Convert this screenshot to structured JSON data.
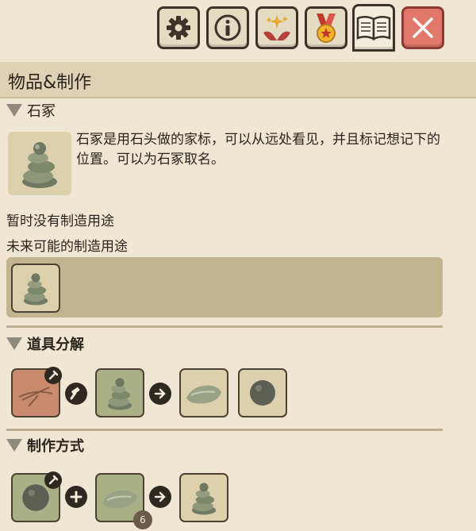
{
  "toolbar": {
    "buttons": [
      {
        "name": "settings",
        "icon": "gear-icon"
      },
      {
        "name": "info",
        "icon": "info-icon"
      },
      {
        "name": "achievements",
        "icon": "sparkle-hands-icon"
      },
      {
        "name": "medals",
        "icon": "medal-icon"
      },
      {
        "name": "book",
        "icon": "book-icon",
        "active": true
      },
      {
        "name": "close",
        "icon": "close-icon"
      }
    ]
  },
  "header": {
    "title": "物品&制作"
  },
  "item": {
    "name": "石冢",
    "icon": "stone-cairn-icon",
    "description": "石冢是用石头做的家标，可以从远处看见，并且标记想记下的位置。可以为石冢取名。"
  },
  "usage": {
    "none_text": "暂时没有制造用途",
    "future_label": "未来可能的制造用途",
    "future_items": [
      {
        "icon": "stone-cairn-icon"
      }
    ]
  },
  "salvage": {
    "heading": "道具分解",
    "tool": {
      "icon": "pickaxe-icon",
      "overlay": "hammer-icon"
    },
    "input": {
      "icon": "stone-cairn-icon"
    },
    "outputs": [
      {
        "icon": "stone-slab-icon"
      },
      {
        "icon": "round-stone-icon"
      }
    ]
  },
  "crafting": {
    "heading": "制作方式",
    "ingredients": [
      {
        "icon": "round-stone-icon",
        "overlay": "tool-icon"
      },
      {
        "icon": "stone-slab-icon",
        "count": "6"
      }
    ],
    "result": {
      "icon": "stone-cairn-icon"
    }
  },
  "colors": {
    "background": "#efe7d3",
    "panel": "#c2b491",
    "close": "#e2786b",
    "ring_dark": "#2d2820"
  }
}
